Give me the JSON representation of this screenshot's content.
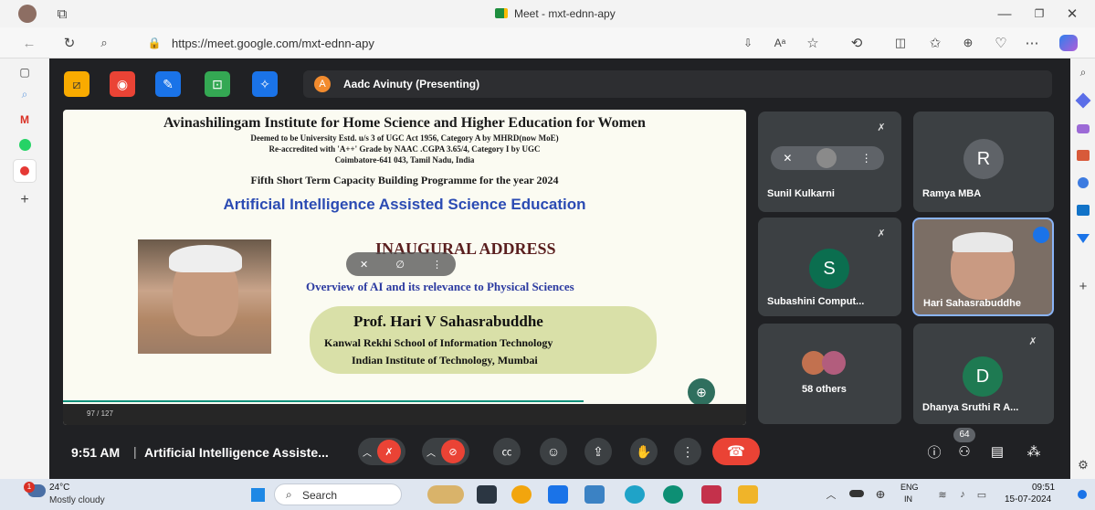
{
  "window": {
    "title": "Meet - mxt-ednn-apy"
  },
  "browser": {
    "url": "https://meet.google.com/mxt-ednn-apy"
  },
  "presenter": {
    "initial": "A",
    "label": "Aadc Avinuty (Presenting)"
  },
  "slide": {
    "institution": "Avinashilingam Institute for Home Science and Higher Education for Women",
    "line1": "Deemed to be University Estd. u/s 3 of UGC Act 1956, Category A by MHRD(now MoE)",
    "line2": "Re-accredited with 'A++' Grade by NAAC .CGPA 3.65/4, Category I by UGC",
    "line3": "Coimbatore-641 043, Tamil Nadu, India",
    "programme": "Fifth Short Term Capacity Building Programme for the year 2024",
    "theme": "Artificial Intelligence Assisted Science Education",
    "address_title": "INAUGURAL ADDRESS",
    "topic": "Overview of AI and its relevance to Physical Sciences",
    "speaker": "Prof. Hari V Sahasrabuddhe",
    "affil1": "Kanwal Rekhi School of Information Technology",
    "affil2": "Indian Institute of Technology, Mumbai",
    "page": "97 / 127"
  },
  "participants": [
    {
      "name": "Sunil Kulkarni"
    },
    {
      "name": "Ramya MBA",
      "initial": "R",
      "color": "#5f6368"
    },
    {
      "name": "Subashini Comput...",
      "initial": "S",
      "color": "#0b6e4f"
    },
    {
      "name": "Hari Sahasrabuddhe"
    },
    {
      "name": "58 others"
    },
    {
      "name": "Dhanya Sruthi R A...",
      "initial": "D",
      "color": "#1e7a52"
    }
  ],
  "controls": {
    "time": "9:51 AM",
    "separator": "|",
    "meeting_title": "Artificial Intelligence Assiste...",
    "people_count": "64",
    "end_color": "#ea4335"
  },
  "taskbar": {
    "weather_temp": "24°C",
    "weather_desc": "Mostly cloudy",
    "weather_badge": "1",
    "search": "Search",
    "lang1": "ENG",
    "lang2": "IN",
    "clock_time": "09:51",
    "clock_date": "15-07-2024"
  }
}
